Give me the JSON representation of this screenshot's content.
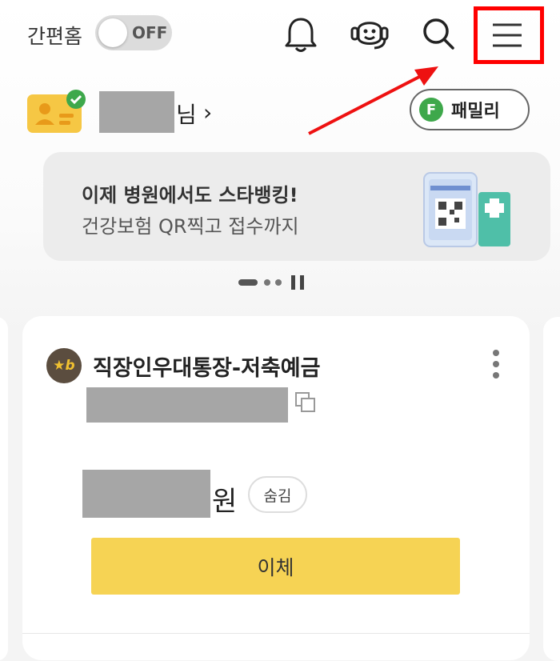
{
  "header": {
    "simple_mode_label": "간편홈",
    "simple_mode_toggle": "OFF",
    "icons": [
      "bell-icon",
      "chatbot-icon",
      "search-icon",
      "menu-icon"
    ]
  },
  "profile": {
    "name_suffix": "님",
    "chevron": "›",
    "family_badge": "F",
    "family_label": "패밀리"
  },
  "banner": {
    "title": "이제 병원에서도 스타뱅킹!",
    "subtitle": "건강보험 QR찍고 접수까지"
  },
  "account": {
    "logo_text": "★b",
    "name": "직장인우대통장-저축예금",
    "currency_unit": "원",
    "hide_label": "숨김",
    "transfer_label": "이체"
  },
  "colors": {
    "accent_yellow": "#f6d354",
    "highlight_red": "#ff0000",
    "family_green": "#3ea84b",
    "mask_gray": "#a6a6a6"
  }
}
